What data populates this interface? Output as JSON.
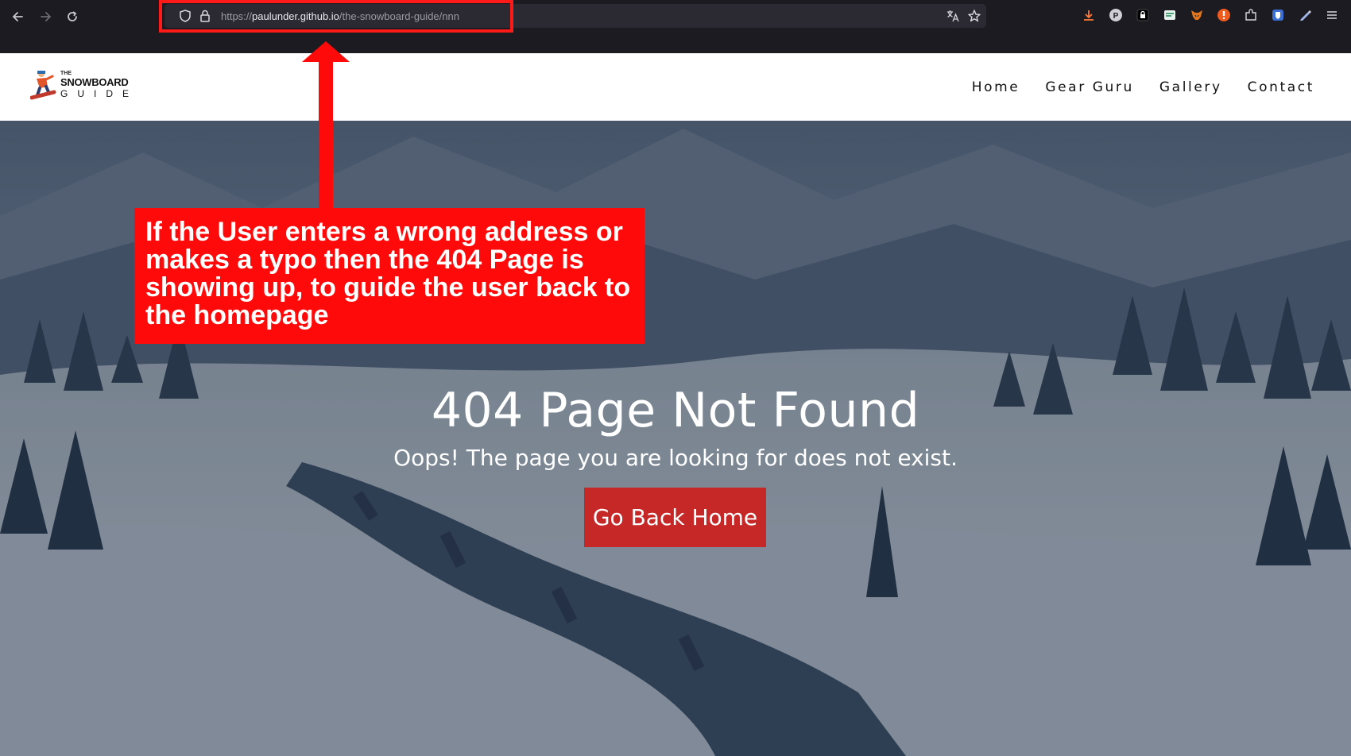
{
  "browser": {
    "url_prefix": "https://",
    "url_host": "paulunder.github.io",
    "url_path": "/the-snowboard-guide/nnn"
  },
  "site": {
    "logo": {
      "the": "THE",
      "snowboard": "SNOWBOARD",
      "guide": "GUIDE"
    },
    "nav": [
      {
        "label": "Home"
      },
      {
        "label": "Gear Guru"
      },
      {
        "label": "Gallery"
      },
      {
        "label": "Contact"
      }
    ]
  },
  "hero": {
    "title": "404 Page Not Found",
    "subtitle": "Oops! The page you are looking for does not exist.",
    "button_label": "Go Back Home"
  },
  "annotation": {
    "text": "If the User enters a wrong address or makes a typo then the 404 Page is showing up, to guide the user back to the homepage",
    "color": "#ff0a0a"
  },
  "colors": {
    "button": "#c62828",
    "header_bg": "#ffffff"
  }
}
